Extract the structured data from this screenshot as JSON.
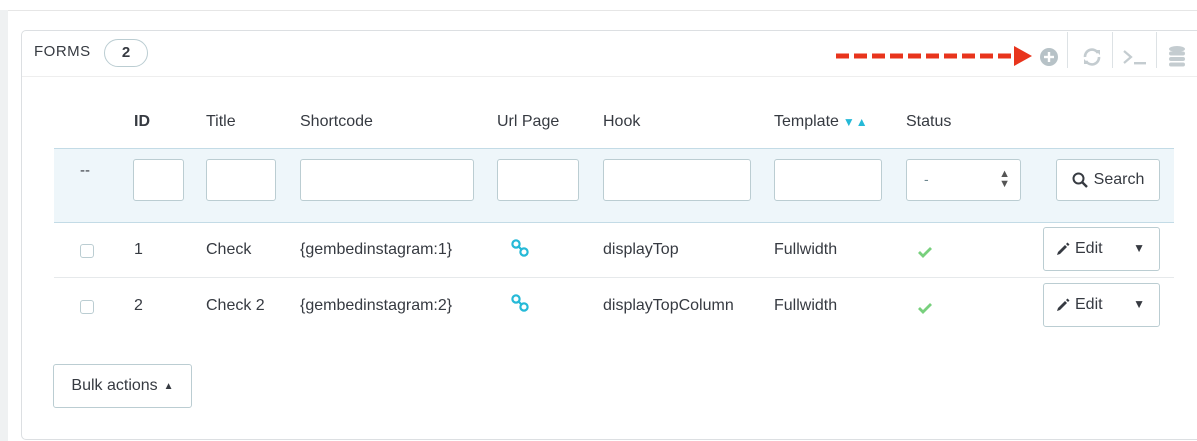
{
  "panel": {
    "title": "FORMS",
    "count": "2"
  },
  "toolbar": {
    "add_icon": "plus-circle-icon",
    "refresh_icon": "refresh-icon",
    "sql_icon": "terminal-icon",
    "export_icon": "database-icon"
  },
  "table": {
    "columns": {
      "id": "ID",
      "title": "Title",
      "shortcode": "Shortcode",
      "url_page": "Url Page",
      "hook": "Hook",
      "template": "Template",
      "status": "Status"
    },
    "filter": {
      "dash": "--",
      "status_selected": "-",
      "search_label": "Search"
    },
    "rows": [
      {
        "id": "1",
        "title": "Check",
        "shortcode": "{gembedinstagram:1}",
        "hook": "displayTop",
        "template": "Fullwidth",
        "status": "enabled",
        "edit_label": "Edit"
      },
      {
        "id": "2",
        "title": "Check 2",
        "shortcode": "{gembedinstagram:2}",
        "hook": "displayTopColumn",
        "template": "Fullwidth",
        "status": "enabled",
        "edit_label": "Edit"
      }
    ]
  },
  "footer": {
    "bulk_actions_label": "Bulk actions"
  },
  "colors": {
    "accent": "#25b9d7",
    "success": "#78d07d",
    "arrow": "#e8341c",
    "filter_bg": "#eef6fa"
  }
}
